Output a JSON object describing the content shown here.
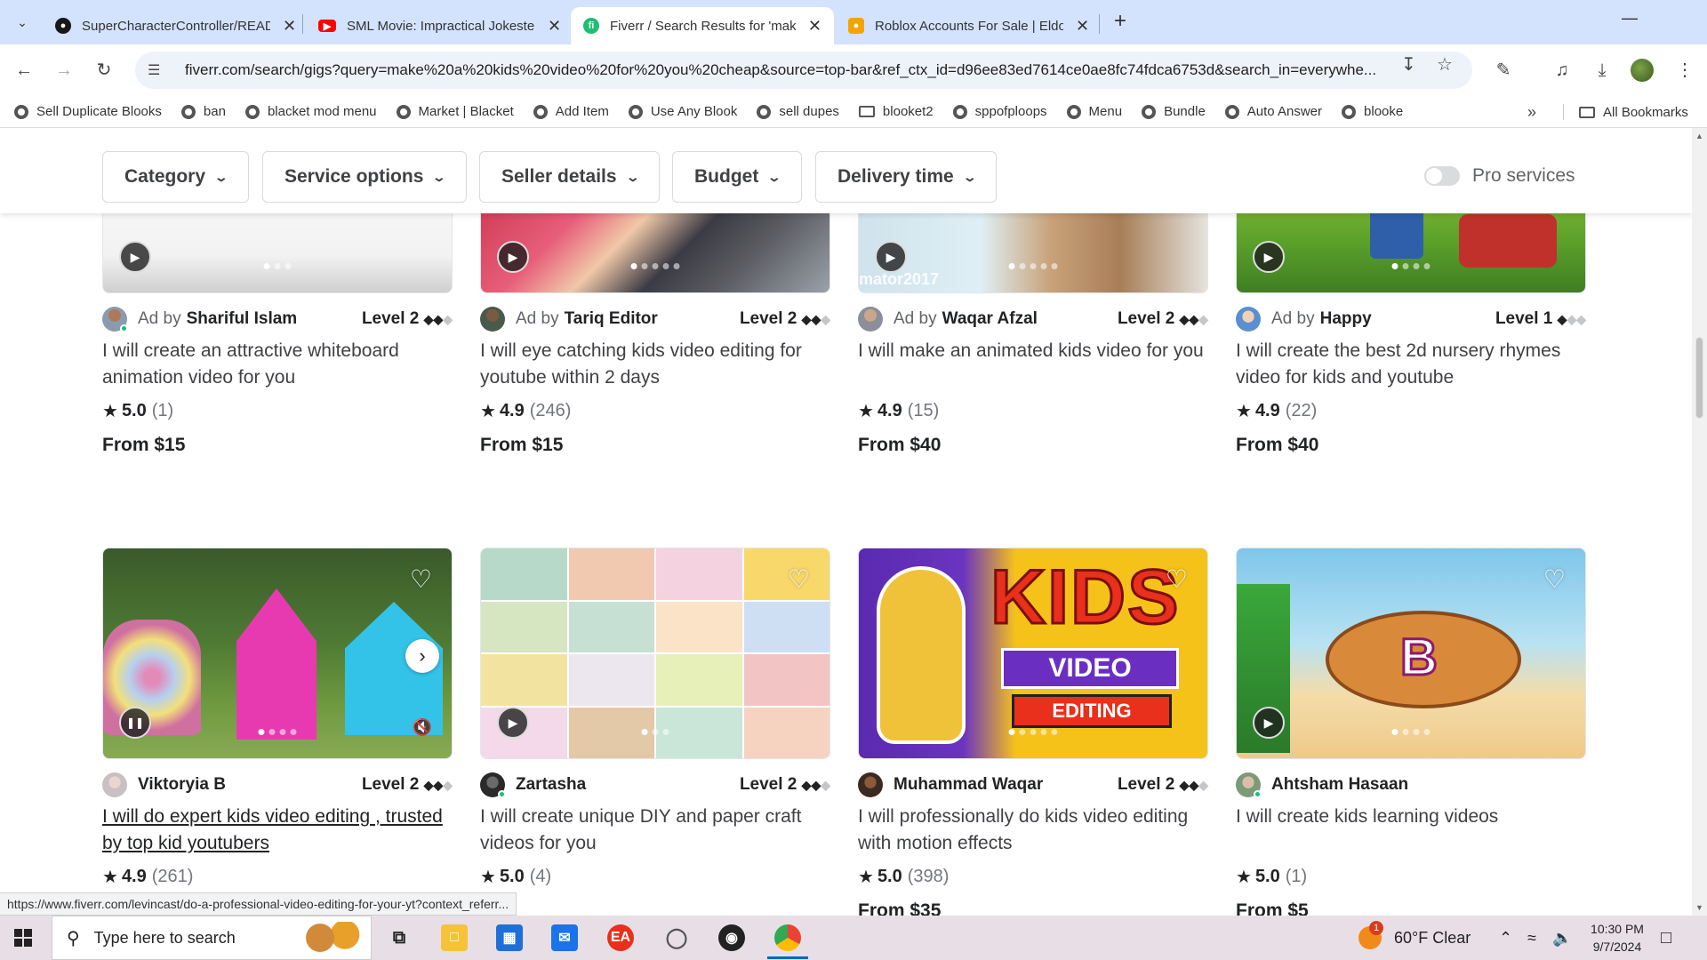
{
  "browser": {
    "tabs": [
      {
        "title": "SuperCharacterController/READ",
        "icon": "github-icon",
        "color": "#181717"
      },
      {
        "title": "SML Movie: Impractical Jokeste",
        "icon": "youtube-icon",
        "color": "#ff0000"
      },
      {
        "title": "Fiverr / Search Results for 'make",
        "icon": "fiverr-icon",
        "color": "#1dbf73"
      },
      {
        "title": "Roblox Accounts For Sale | Eldo",
        "icon": "eldorado-icon",
        "color": "#f4a400"
      }
    ],
    "url": "fiverr.com/search/gigs?query=make%20a%20kids%20video%20for%20you%20cheap&source=top-bar&ref_ctx_id=d96ee83ed7614ce0ae8fc74fdca6753d&search_in=everywhe...",
    "bookmarks": [
      "Sell Duplicate Blooks",
      "ban",
      "blacket mod menu",
      "Market | Blacket",
      "Add Item",
      "Use Any Blook",
      "sell dupes",
      "blooket2",
      "sppofploops",
      "Menu",
      "Bundle",
      "Auto Answer",
      "blooke"
    ],
    "all_bookmarks": "All Bookmarks",
    "status_url": "https://www.fiverr.com/levincast/do-a-professional-video-editing-for-your-yt?context_referr..."
  },
  "filters": {
    "category": "Category",
    "service_options": "Service options",
    "seller_details": "Seller details",
    "budget": "Budget",
    "delivery_time": "Delivery time",
    "pro_services": "Pro services"
  },
  "gigs": [
    {
      "ad": "Ad by",
      "seller": "Shariful Islam",
      "level": "Level 2",
      "title": "I will create an attractive whiteboard animation video for you",
      "rating": "5.0",
      "count": "(1)",
      "price": "From $15"
    },
    {
      "ad": "Ad by",
      "seller": "Tariq Editor",
      "level": "Level 2",
      "title": "I will eye catching kids video editing for youtube within 2 days",
      "rating": "4.9",
      "count": "(246)",
      "price": "From $15"
    },
    {
      "ad": "Ad by",
      "seller": "Waqar Afzal",
      "level": "Level 2",
      "title": "I will make an animated kids video for you",
      "rating": "4.9",
      "count": "(15)",
      "price": "From $40",
      "watermark": "mator2017"
    },
    {
      "ad": "Ad by",
      "seller": "Happy",
      "level": "Level 1",
      "title": "I will create the best 2d nursery rhymes video for kids and youtube",
      "rating": "4.9",
      "count": "(22)",
      "price": "From $40"
    },
    {
      "ad": "",
      "seller": "Viktoryia B",
      "level": "Level 2",
      "title": "I will do expert kids video editing , trusted by top kid youtubers",
      "rating": "4.9",
      "count": "(261)",
      "price": ""
    },
    {
      "ad": "",
      "seller": "Zartasha",
      "level": "Level 2",
      "title": "I will create unique DIY and paper craft videos for you",
      "rating": "5.0",
      "count": "(4)",
      "price": ""
    },
    {
      "ad": "",
      "seller": "Muhammad Waqar",
      "level": "Level 2",
      "title": "I will professionally do kids video editing with motion effects",
      "rating": "5.0",
      "count": "(398)",
      "price": "From $35",
      "thumb_text_1": "KIDS",
      "thumb_text_2": "VIDEO",
      "thumb_text_3": "EDITING"
    },
    {
      "ad": "",
      "seller": "Ahtsham Hasaan",
      "level": "",
      "title": "I will create kids learning videos",
      "rating": "5.0",
      "count": "(1)",
      "price": "From $5",
      "thumb_text_1": "B"
    }
  ],
  "taskbar": {
    "search_placeholder": "Type here to search",
    "weather": "60°F  Clear",
    "weather_badge": "1",
    "time": "10:30 PM",
    "date": "9/7/2024"
  },
  "colors": {
    "tabbar": "#d3e3fd",
    "fiverr_green": "#1dbf73",
    "taskbar": "#e8dfe6"
  }
}
